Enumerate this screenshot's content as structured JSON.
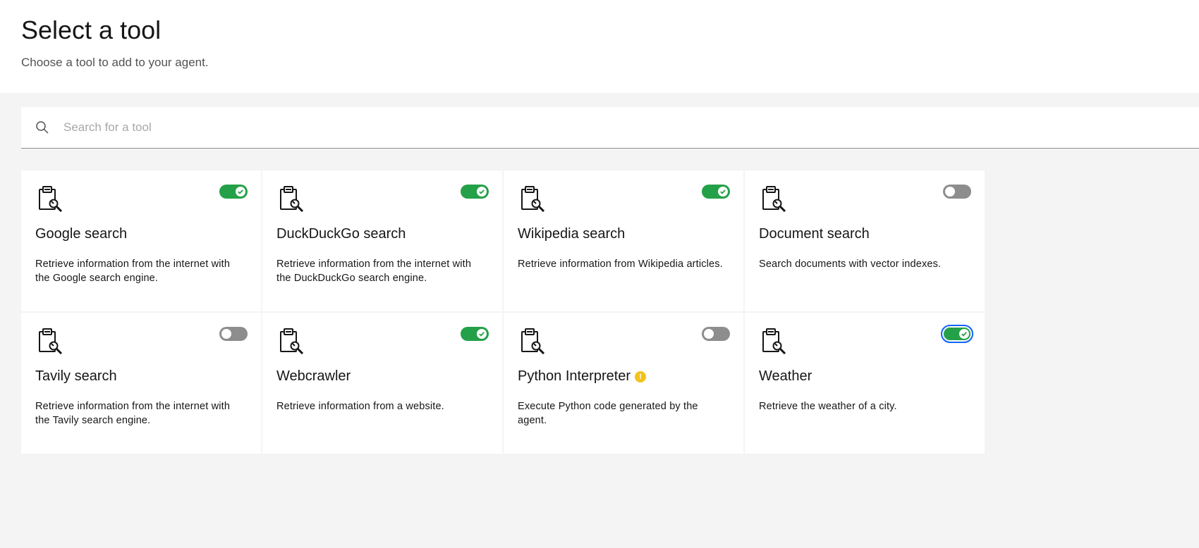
{
  "header": {
    "title": "Select a tool",
    "subtitle": "Choose a tool to add to your agent."
  },
  "search": {
    "placeholder": "Search for a tool",
    "value": "",
    "icon": "search-icon"
  },
  "tools": [
    {
      "name": "Google search",
      "description": "Retrieve information from the internet with the Google search engine.",
      "enabled": true,
      "icon": "clipboard-wrench-icon"
    },
    {
      "name": "DuckDuckGo search",
      "description": "Retrieve information from the internet with the DuckDuckGo search engine.",
      "enabled": true,
      "icon": "clipboard-wrench-icon"
    },
    {
      "name": "Wikipedia search",
      "description": "Retrieve information from Wikipedia articles.",
      "enabled": true,
      "icon": "clipboard-wrench-icon"
    },
    {
      "name": "Document search",
      "description": "Search documents with vector indexes.",
      "enabled": false,
      "icon": "clipboard-wrench-icon"
    },
    {
      "name": "Tavily search",
      "description": "Retrieve information from the internet with the Tavily search engine.",
      "enabled": false,
      "icon": "clipboard-wrench-icon"
    },
    {
      "name": "Webcrawler",
      "description": "Retrieve information from a website.",
      "enabled": true,
      "icon": "clipboard-wrench-icon"
    },
    {
      "name": "Python Interpreter",
      "description": "Execute Python code generated by the agent.",
      "enabled": false,
      "icon": "clipboard-wrench-icon",
      "warning": true
    },
    {
      "name": "Weather",
      "description": "Retrieve the weather of a city.",
      "enabled": true,
      "icon": "clipboard-wrench-icon",
      "focused": true
    }
  ],
  "colors": {
    "toggle_on": "#24a148",
    "toggle_off": "#8d8d8d",
    "focus": "#0f62fe",
    "warning": "#f1c21b"
  }
}
